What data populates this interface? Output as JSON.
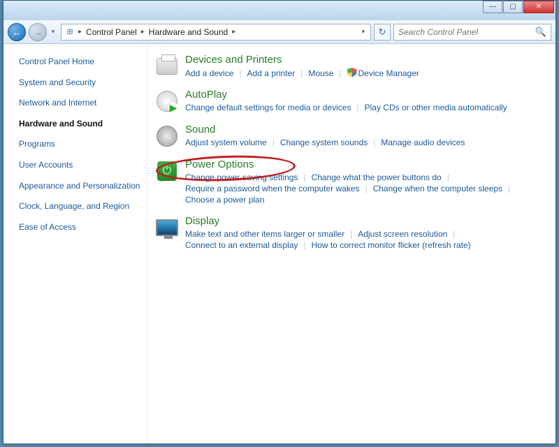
{
  "window": {
    "min": "—",
    "max": "▢",
    "close": "✕"
  },
  "nav": {
    "back_glyph": "←",
    "fwd_glyph": "→",
    "drop_glyph": "▾",
    "breadcrumb": [
      "Control Panel",
      "Hardware and Sound"
    ],
    "arrow": "▸",
    "refresh_glyph": "↻"
  },
  "search": {
    "placeholder": "Search Control Panel"
  },
  "sidebar": {
    "home": "Control Panel Home",
    "items": [
      "System and Security",
      "Network and Internet",
      "Hardware and Sound",
      "Programs",
      "User Accounts",
      "Appearance and Personalization",
      "Clock, Language, and Region",
      "Ease of Access"
    ],
    "active_index": 2
  },
  "categories": [
    {
      "id": "devices",
      "title": "Devices and Printers",
      "links": [
        {
          "text": "Add a device"
        },
        {
          "text": "Add a printer"
        },
        {
          "text": "Mouse"
        },
        {
          "text": "Device Manager",
          "shield": true
        }
      ]
    },
    {
      "id": "autoplay",
      "title": "AutoPlay",
      "links": [
        {
          "text": "Change default settings for media or devices"
        },
        {
          "text": "Play CDs or other media automatically"
        }
      ]
    },
    {
      "id": "sound",
      "title": "Sound",
      "links": [
        {
          "text": "Adjust system volume"
        },
        {
          "text": "Change system sounds"
        },
        {
          "text": "Manage audio devices"
        }
      ]
    },
    {
      "id": "power",
      "title": "Power Options",
      "links": [
        {
          "text": "Change power-saving settings"
        },
        {
          "text": "Change what the power buttons do"
        },
        {
          "text": "Require a password when the computer wakes"
        },
        {
          "text": "Change when the computer sleeps"
        },
        {
          "text": "Choose a power plan"
        }
      ]
    },
    {
      "id": "display",
      "title": "Display",
      "links": [
        {
          "text": "Make text and other items larger or smaller"
        },
        {
          "text": "Adjust screen resolution"
        },
        {
          "text": "Connect to an external display"
        },
        {
          "text": "How to correct monitor flicker (refresh rate)"
        }
      ]
    }
  ],
  "annotation": {
    "highlighted_category": "power"
  }
}
